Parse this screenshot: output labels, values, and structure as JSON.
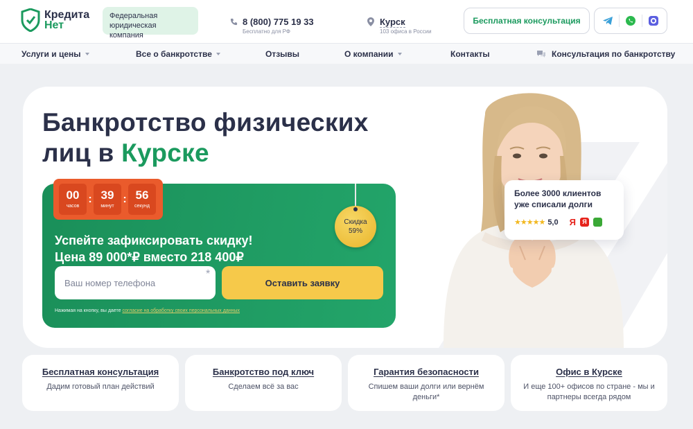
{
  "header": {
    "logo": {
      "line1": "Кредита",
      "line2": "Нет"
    },
    "company_badge": "Федеральная юридическая компания",
    "phone": {
      "number": "8 (800) 775 19 33",
      "note": "Бесплатно для РФ",
      "icon": "phone-icon"
    },
    "city": {
      "name": "Курск",
      "note": "103 офиса в России",
      "icon": "location-pin-icon"
    },
    "consult_button": "Бесплатная консультация",
    "socials": [
      "telegram-icon",
      "whatsapp-icon",
      "max-messenger-icon"
    ]
  },
  "nav": {
    "items": [
      {
        "label": "Услуги и цены",
        "dropdown": true
      },
      {
        "label": "Все о банкротстве",
        "dropdown": true
      },
      {
        "label": "Отзывы",
        "dropdown": false
      },
      {
        "label": "О компании",
        "dropdown": true
      },
      {
        "label": "Контакты",
        "dropdown": false
      },
      {
        "label": "Консультация по банкротству",
        "dropdown": false
      }
    ]
  },
  "hero": {
    "title_part1": "Банкротство физических",
    "title_part2": "лиц в ",
    "title_accent": "Курске",
    "timer": {
      "hours": "00",
      "hours_label": "часов",
      "minutes": "39",
      "minutes_label": "минут",
      "seconds": "56",
      "seconds_label": "секунд"
    },
    "promo_line1": "Успейте зафиксировать скидку!",
    "promo_line2": "Цена 89 000*₽ вместо 218 400₽",
    "discount_label": "Скидка",
    "discount_value": "59%",
    "phone_placeholder": "Ваш номер телефона",
    "submit_label": "Оставить заявку",
    "consent_text": "Нажимая на кнопку, вы даете ",
    "consent_link": "согласие на обработку своих персональных данных",
    "review": {
      "line1": "Более 3000 клиентов",
      "line2": "уже списали долги",
      "stars": "★★★★★",
      "rating": "5,0",
      "yandex": "Я"
    }
  },
  "features": [
    {
      "title": "Бесплатная консультация",
      "desc": "Дадим готовый план действий"
    },
    {
      "title": "Банкротство под ключ",
      "desc": "Сделаем всё за вас"
    },
    {
      "title": "Гарантия безопасности",
      "desc": "Спишем ваши долги или вернём деньги*"
    },
    {
      "title": "Офис в Курске",
      "desc": "И еще 100+ офисов по стране - мы и партнеры всегда рядом"
    }
  ],
  "colors": {
    "brand_green": "#1b9a5e",
    "accent_yellow": "#f6c94a",
    "timer_orange": "#ea5b2c",
    "text_dark": "#2b3049"
  }
}
